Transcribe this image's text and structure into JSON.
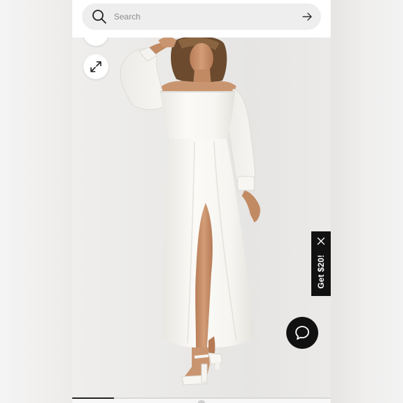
{
  "search": {
    "placeholder": "Search",
    "icon": "search-icon",
    "submit_icon": "arrow-right-icon"
  },
  "viewer": {
    "zoom_icon": "expand-icon",
    "scroll_up_icon": "chevron-up-icon"
  },
  "promo": {
    "label": "Get $20!",
    "close_icon": "close-icon",
    "color": "#111111"
  },
  "chat": {
    "icon": "chat-bubble-icon",
    "color": "#111111"
  },
  "gallery": {
    "progress": 0.16
  },
  "colors": {
    "background": "#ecebe9",
    "dress": "#f7f6f2",
    "skin": "#c9926b",
    "hair": "#6b4a2e"
  }
}
